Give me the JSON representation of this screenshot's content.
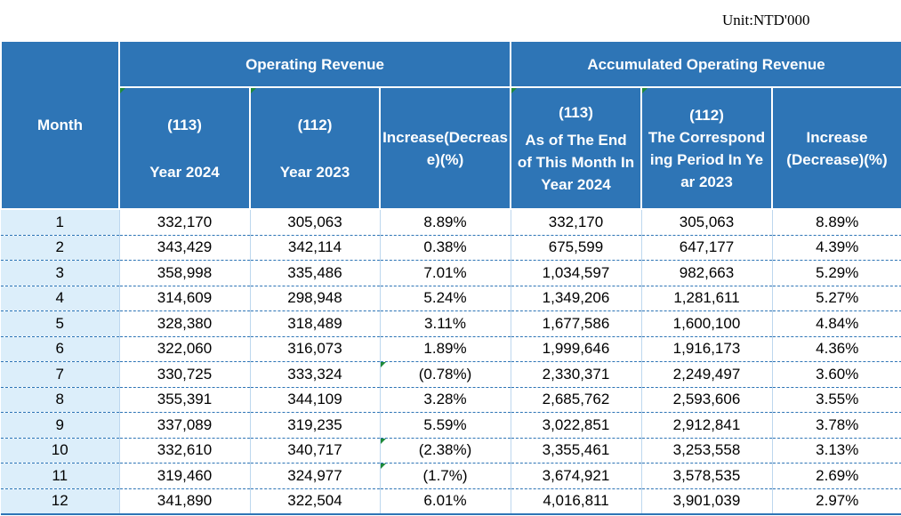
{
  "unit": "Unit:NTD'000",
  "headers": {
    "month": "Month",
    "operating_revenue": "Operating Revenue",
    "accumulated_operating_revenue": "Accumulated Operating Revenue",
    "op_113_code": "(113)",
    "op_113_label": "Year 2024",
    "op_112_code": "(112)",
    "op_112_label": "Year 2023",
    "op_change": "Increase(Decrease)(%)",
    "acc_113_code": "(113)",
    "acc_113_label": "As of The End of This Month In Year 2024",
    "acc_112_code": "(112)",
    "acc_112_label": "The Corresponding Period In Year 2023",
    "acc_change": "Increase (Decrease)(%)"
  },
  "rows": [
    {
      "month": "1",
      "rev_2024": "332,170",
      "rev_2023": "305,063",
      "rev_change": "8.89%",
      "acc_2024": "332,170",
      "acc_2023": "305,063",
      "acc_change": "8.89%"
    },
    {
      "month": "2",
      "rev_2024": "343,429",
      "rev_2023": "342,114",
      "rev_change": "0.38%",
      "acc_2024": "675,599",
      "acc_2023": "647,177",
      "acc_change": "4.39%"
    },
    {
      "month": "3",
      "rev_2024": "358,998",
      "rev_2023": "335,486",
      "rev_change": "7.01%",
      "acc_2024": "1,034,597",
      "acc_2023": "982,663",
      "acc_change": "5.29%"
    },
    {
      "month": "4",
      "rev_2024": "314,609",
      "rev_2023": "298,948",
      "rev_change": "5.24%",
      "acc_2024": "1,349,206",
      "acc_2023": "1,281,611",
      "acc_change": "5.27%"
    },
    {
      "month": "5",
      "rev_2024": "328,380",
      "rev_2023": "318,489",
      "rev_change": "3.11%",
      "acc_2024": "1,677,586",
      "acc_2023": "1,600,100",
      "acc_change": "4.84%"
    },
    {
      "month": "6",
      "rev_2024": "322,060",
      "rev_2023": "316,073",
      "rev_change": "1.89%",
      "acc_2024": "1,999,646",
      "acc_2023": "1,916,173",
      "acc_change": "4.36%"
    },
    {
      "month": "7",
      "rev_2024": "330,725",
      "rev_2023": "333,324",
      "rev_change": "(0.78%)",
      "acc_2024": "2,330,371",
      "acc_2023": "2,249,497",
      "acc_change": "3.60%"
    },
    {
      "month": "8",
      "rev_2024": "355,391",
      "rev_2023": "344,109",
      "rev_change": "3.28%",
      "acc_2024": "2,685,762",
      "acc_2023": "2,593,606",
      "acc_change": "3.55%"
    },
    {
      "month": "9",
      "rev_2024": "337,089",
      "rev_2023": "319,235",
      "rev_change": "5.59%",
      "acc_2024": "3,022,851",
      "acc_2023": "2,912,841",
      "acc_change": "3.78%"
    },
    {
      "month": "10",
      "rev_2024": "332,610",
      "rev_2023": "340,717",
      "rev_change": "(2.38%)",
      "acc_2024": "3,355,461",
      "acc_2023": "3,253,558",
      "acc_change": "3.13%"
    },
    {
      "month": "11",
      "rev_2024": "319,460",
      "rev_2023": "324,977",
      "rev_change": "(1.7%)",
      "acc_2024": "3,674,921",
      "acc_2023": "3,578,535",
      "acc_change": "2.69%"
    },
    {
      "month": "12",
      "rev_2024": "341,890",
      "rev_2023": "322,504",
      "rev_change": "6.01%",
      "acc_2024": "4,016,811",
      "acc_2023": "3,901,039",
      "acc_change": "2.97%"
    }
  ],
  "colors": {
    "header_bg": "#2e75b6",
    "month_bg": "#dceefa",
    "marker": "#1f8a3a"
  }
}
